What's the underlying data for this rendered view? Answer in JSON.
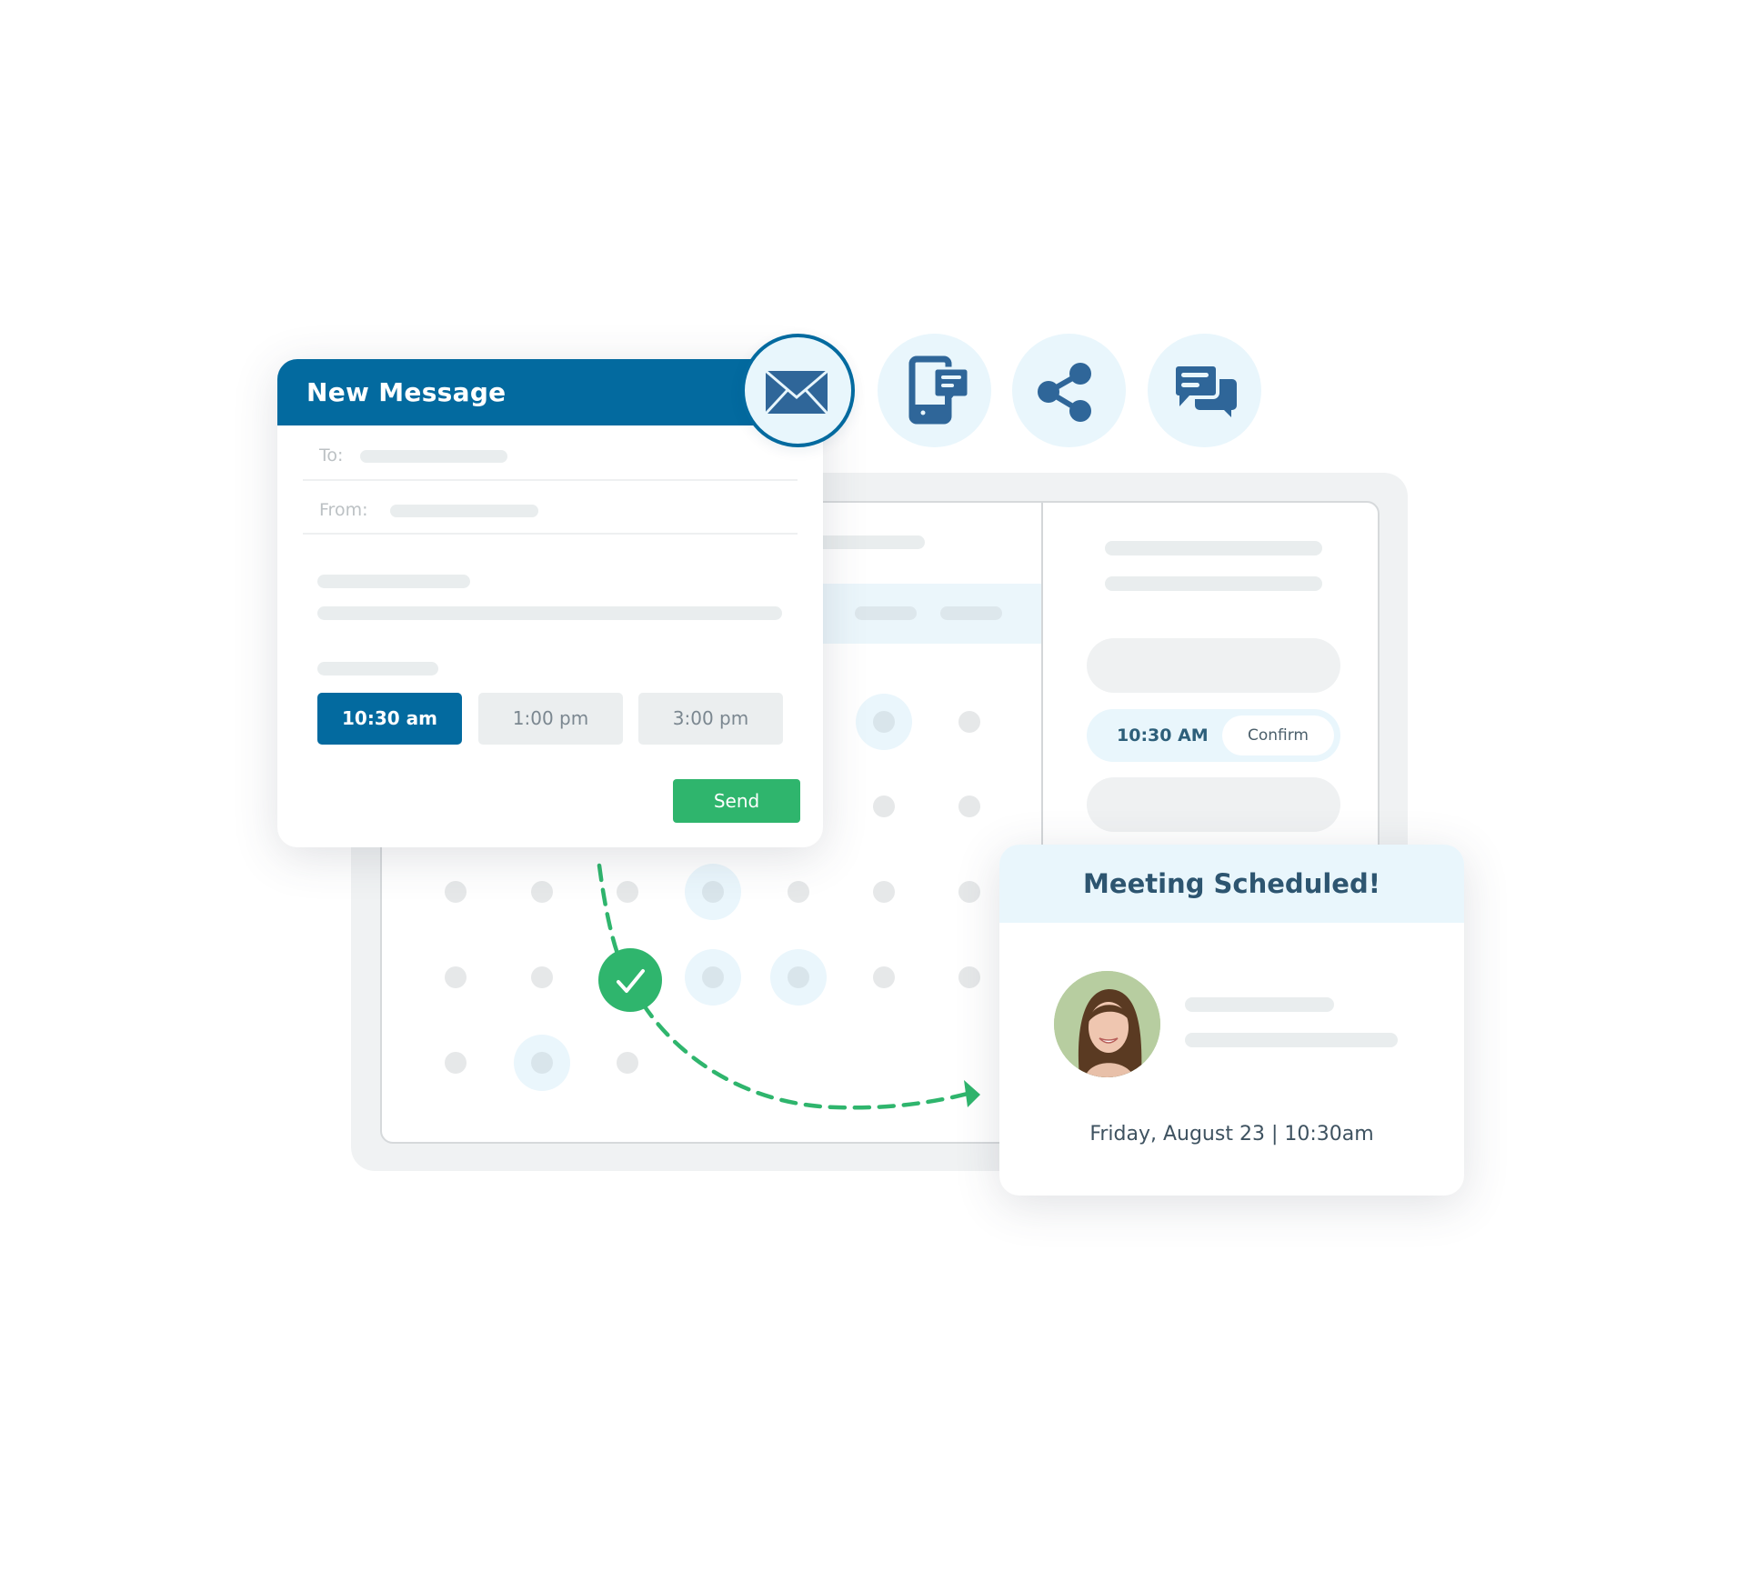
{
  "message_card": {
    "title": "New Message",
    "to_label": "To:",
    "from_label": "From:",
    "time_slots": [
      {
        "label": "10:30 am",
        "selected": true
      },
      {
        "label": "1:00 pm",
        "selected": false
      },
      {
        "label": "3:00 pm",
        "selected": false
      }
    ],
    "send_label": "Send"
  },
  "channels": [
    {
      "icon": "envelope-icon",
      "active": true
    },
    {
      "icon": "mobile-message-icon",
      "active": false
    },
    {
      "icon": "share-icon",
      "active": false
    },
    {
      "icon": "chat-bubbles-icon",
      "active": false
    }
  ],
  "scheduler_panel": {
    "selected_time": "10:30 AM",
    "confirm_label": "Confirm"
  },
  "meeting_card": {
    "title": "Meeting Scheduled!",
    "date_time": "Friday, August 23 | 10:30am"
  },
  "colors": {
    "primary_blue": "#036a9f",
    "icon_blue": "#2f6699",
    "success_green": "#2fb56d",
    "light_blue_bg": "#e9f6fc",
    "heading_text": "#2d5570"
  }
}
